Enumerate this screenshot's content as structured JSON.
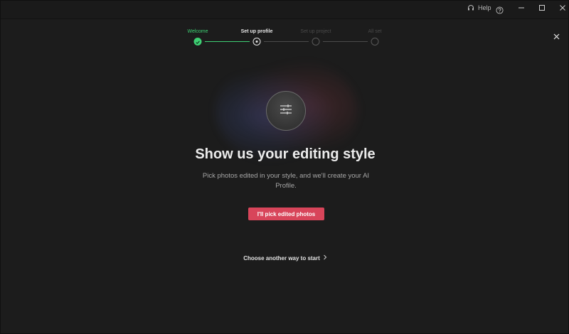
{
  "titlebar": {
    "help_label": "Help",
    "icons": {
      "help": "headset-icon",
      "question": "question-circle-icon",
      "minimize": "minimize-icon",
      "maximize": "maximize-icon",
      "close": "close-icon"
    }
  },
  "stepper": {
    "steps": [
      {
        "label": "Welcome",
        "state": "done"
      },
      {
        "label": "Set up profile",
        "state": "active"
      },
      {
        "label": "Set up project",
        "state": "todo"
      },
      {
        "label": "All set",
        "state": "todo"
      }
    ]
  },
  "main": {
    "icon": "sliders-icon",
    "headline": "Show us your editing style",
    "subtext": "Pick photos edited in your style, and we'll create your AI Profile.",
    "cta_label": "I'll pick edited photos",
    "alt_link_label": "Choose another way to start"
  },
  "colors": {
    "accent_green": "#3ecf73",
    "cta_red": "#d8455a",
    "background": "#1c1c1c"
  }
}
